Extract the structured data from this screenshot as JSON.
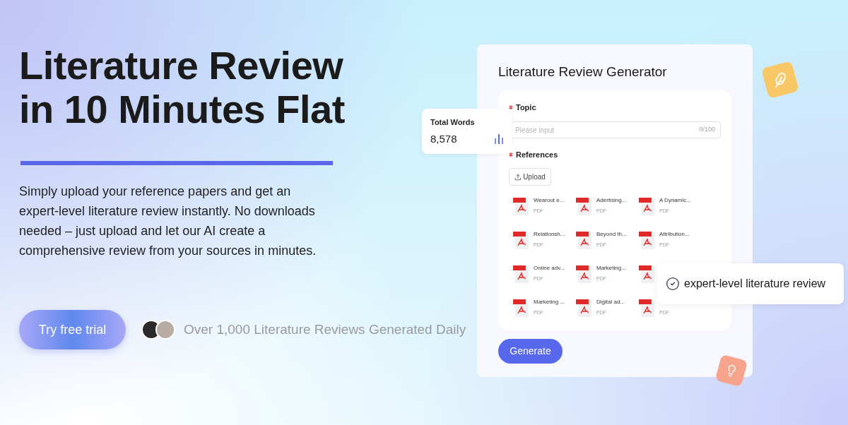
{
  "hero": {
    "headline": [
      "Literature Review",
      "in 10 Minutes Flat"
    ],
    "description": "Simply upload your reference papers and get an expert-level literature review instantly. No downloads needed – just upload and let our AI create a comprehensive review from your sources in minutes.",
    "cta": "Try free trial",
    "social_proof": "Over 1,000 Literature Reviews Generated Daily"
  },
  "generator": {
    "title": "Literature Review Generator",
    "topic": {
      "label": "Topic",
      "required": true,
      "placeholder": "Please input",
      "counter": "0/100"
    },
    "references": {
      "label": "References",
      "required": true,
      "upload": "Upload",
      "files": [
        {
          "kind": "pdf",
          "name": "Wearout e...",
          "type": "PDF"
        },
        {
          "kind": "pdf",
          "name": "Adertising...",
          "type": "PDF"
        },
        {
          "kind": "pdf",
          "name": "A Dynamic...",
          "type": "PDF"
        },
        {
          "kind": "pdf",
          "name": "Relationsh...",
          "type": "PDF"
        },
        {
          "kind": "pdf",
          "name": "Beyond th...",
          "type": "PDF"
        },
        {
          "kind": "pdf",
          "name": "Attribution...",
          "type": "PDF"
        },
        {
          "kind": "pdf",
          "name": "Online adv...",
          "type": "PDF"
        },
        {
          "kind": "pdf",
          "name": "Marketing...",
          "type": "PDF"
        },
        {
          "kind": "pdf"
        },
        {
          "kind": "pdf",
          "name": "Marketing ...",
          "type": "PDF"
        },
        {
          "kind": "pdf",
          "name": "Digital ad...",
          "type": "PDF"
        },
        {
          "kind": "pdf",
          "type": "PDF"
        }
      ]
    },
    "generate": "Generate"
  },
  "stats_card": {
    "label": "Total Words",
    "value": "8,578"
  },
  "badge": {
    "text": "expert-level literature review"
  }
}
